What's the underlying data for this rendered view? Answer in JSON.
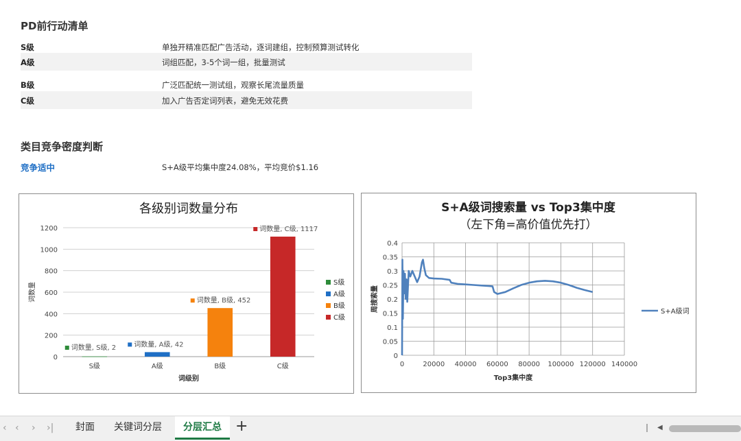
{
  "sections": {
    "actions_title": "PD前行动清单",
    "actions": [
      {
        "level": "S级",
        "desc": "单独开精准匹配广告活动，逐词建组，控制预算测试转化"
      },
      {
        "level": "A级",
        "desc": "词组匹配，3-5个词一组，批量测试"
      },
      {
        "level": "B级",
        "desc": "广泛匹配统一测试组，观察长尾流量质量"
      },
      {
        "level": "C级",
        "desc": "加入广告否定词列表，避免无效花费"
      }
    ],
    "competition_title": "类目竞争密度判断",
    "competition_label": "竞争适中",
    "competition_desc": "S+A级平均集中度24.08%，平均竞价$1.16"
  },
  "colors": {
    "accent_blue": "#1f6fc5",
    "tab_green": "#1e7a44"
  },
  "chart_data": [
    {
      "type": "bar",
      "title": "各级别词数量分布",
      "xlabel": "词级别",
      "ylabel": "词数量",
      "categories": [
        "S级",
        "A级",
        "B级",
        "C级"
      ],
      "values": [
        2,
        42,
        452,
        1117
      ],
      "colors": [
        "#2e8b3a",
        "#1f6fc5",
        "#f5820d",
        "#c62828"
      ],
      "data_labels": [
        "词数量, S级, 2",
        "词数量, A级, 42",
        "词数量, B级, 452",
        "词数量, C级, 1117"
      ],
      "legend": [
        "S级",
        "A级",
        "B级",
        "C级"
      ],
      "legend_position": "right",
      "ylim": [
        0,
        1200
      ],
      "yticks": [
        0,
        200,
        400,
        600,
        800,
        1000,
        1200
      ],
      "grid": true
    },
    {
      "type": "line",
      "title": "S+A级词搜索量 vs Top3集中度",
      "subtitle": "（左下角=高价值优先打）",
      "xlabel": "Top3集中度",
      "ylabel": "周搜索量",
      "series": [
        {
          "name": "S+A级词",
          "color": "#4f81bd",
          "points": [
            [
              0,
              0
            ],
            [
              200,
              0.34
            ],
            [
              500,
              0.13
            ],
            [
              900,
              0.3
            ],
            [
              1300,
              0.22
            ],
            [
              1800,
              0.29
            ],
            [
              2300,
              0.2
            ],
            [
              2800,
              0.27
            ],
            [
              3300,
              0.19
            ],
            [
              4200,
              0.3
            ],
            [
              5200,
              0.28
            ],
            [
              6500,
              0.3
            ],
            [
              8000,
              0.28
            ],
            [
              9500,
              0.26
            ],
            [
              11000,
              0.28
            ],
            [
              12500,
              0.33
            ],
            [
              13200,
              0.34
            ],
            [
              14000,
              0.31
            ],
            [
              15000,
              0.285
            ],
            [
              17000,
              0.275
            ],
            [
              20000,
              0.273
            ],
            [
              25000,
              0.272
            ],
            [
              30000,
              0.268
            ],
            [
              31000,
              0.258
            ],
            [
              35000,
              0.254
            ],
            [
              40000,
              0.252
            ],
            [
              45000,
              0.25
            ],
            [
              50000,
              0.248
            ],
            [
              55000,
              0.246
            ],
            [
              57000,
              0.245
            ],
            [
              58000,
              0.225
            ],
            [
              60000,
              0.218
            ],
            [
              65000,
              0.225
            ],
            [
              70000,
              0.238
            ],
            [
              75000,
              0.25
            ],
            [
              80000,
              0.258
            ],
            [
              85000,
              0.263
            ],
            [
              90000,
              0.265
            ],
            [
              95000,
              0.263
            ],
            [
              100000,
              0.258
            ],
            [
              105000,
              0.25
            ],
            [
              110000,
              0.24
            ],
            [
              115000,
              0.232
            ],
            [
              120000,
              0.225
            ]
          ]
        }
      ],
      "xlim": [
        0,
        140000
      ],
      "ylim": [
        0,
        0.4
      ],
      "xticks": [
        0,
        20000,
        40000,
        60000,
        80000,
        100000,
        120000,
        140000
      ],
      "yticks": [
        0,
        0.05,
        0.1,
        0.15,
        0.2,
        0.25,
        0.3,
        0.35,
        0.4
      ],
      "legend_position": "right",
      "grid": true
    }
  ],
  "tabs": {
    "items": [
      "封面",
      "关键词分层",
      "分层汇总"
    ],
    "active": "分层汇总",
    "add": "+",
    "nav": [
      "‹",
      "‹",
      "›",
      "›|"
    ]
  }
}
